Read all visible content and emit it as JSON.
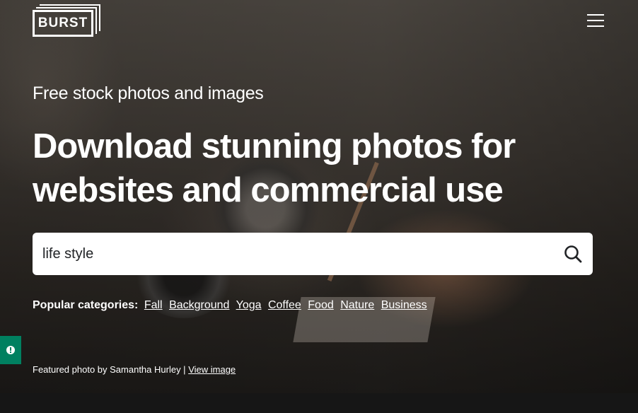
{
  "brand": {
    "logo_text": "BURST"
  },
  "header": {
    "menu_icon": "hamburger-menu-icon"
  },
  "hero": {
    "eyebrow": "Free stock photos and images",
    "headline": "Download stunning photos for websites and commercial use"
  },
  "search": {
    "value": "life style",
    "icon": "search-icon"
  },
  "categories": {
    "label": "Popular categories:",
    "items": [
      "Fall",
      "Background",
      "Yoga",
      "Coffee",
      "Food",
      "Nature",
      "Business"
    ]
  },
  "featured": {
    "prefix": "Featured photo by Samantha Hurley |",
    "link": "View image"
  },
  "feedback": {
    "icon": "alert-icon"
  },
  "colors": {
    "accent_green": "#008060",
    "search_bg": "#ffffff",
    "page_bg": "#161616"
  }
}
